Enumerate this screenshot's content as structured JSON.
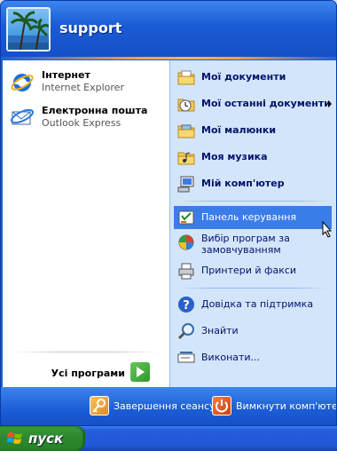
{
  "user": {
    "name": "support"
  },
  "pinned": [
    {
      "title": "Інтернет",
      "subtitle": "Internet Explorer",
      "icon": "internet-explorer-icon"
    },
    {
      "title": "Електронна пошта",
      "subtitle": "Outlook Express",
      "icon": "outlook-express-icon"
    }
  ],
  "all_programs": {
    "label": "Усі програми",
    "icon": "green-arrow-icon"
  },
  "places": [
    {
      "label": "Мої документи",
      "icon": "my-documents-icon",
      "bold": true
    },
    {
      "label": "Мої останні документи",
      "icon": "recent-documents-icon",
      "bold": true,
      "submenu": true
    },
    {
      "label": "Мої малюнки",
      "icon": "my-pictures-icon",
      "bold": true
    },
    {
      "label": "Моя музика",
      "icon": "my-music-icon",
      "bold": true
    },
    {
      "label": "Мій комп'ютер",
      "icon": "my-computer-icon",
      "bold": true
    },
    {
      "label": "Панель керування",
      "icon": "control-panel-icon",
      "highlighted": true
    },
    {
      "label": "Вибір програм за замовчуванням",
      "icon": "default-programs-icon"
    },
    {
      "label": "Принтери й факси",
      "icon": "printers-icon"
    },
    {
      "label": "Довідка та підтримка",
      "icon": "help-icon"
    },
    {
      "label": "Знайти",
      "icon": "search-icon"
    },
    {
      "label": "Виконати...",
      "icon": "run-icon"
    }
  ],
  "footer": {
    "logoff": {
      "label": "Завершення сеансу",
      "icon": "logoff-key-icon"
    },
    "shutdown": {
      "label": "Вимкнути комп'ютер",
      "icon": "power-icon"
    }
  },
  "taskbar": {
    "start_label": "пуск",
    "icon": "windows-flag-icon"
  },
  "colors": {
    "highlight": "#3a7de8",
    "header": "#1a5bd4",
    "start_button": "#2f8a2f"
  }
}
